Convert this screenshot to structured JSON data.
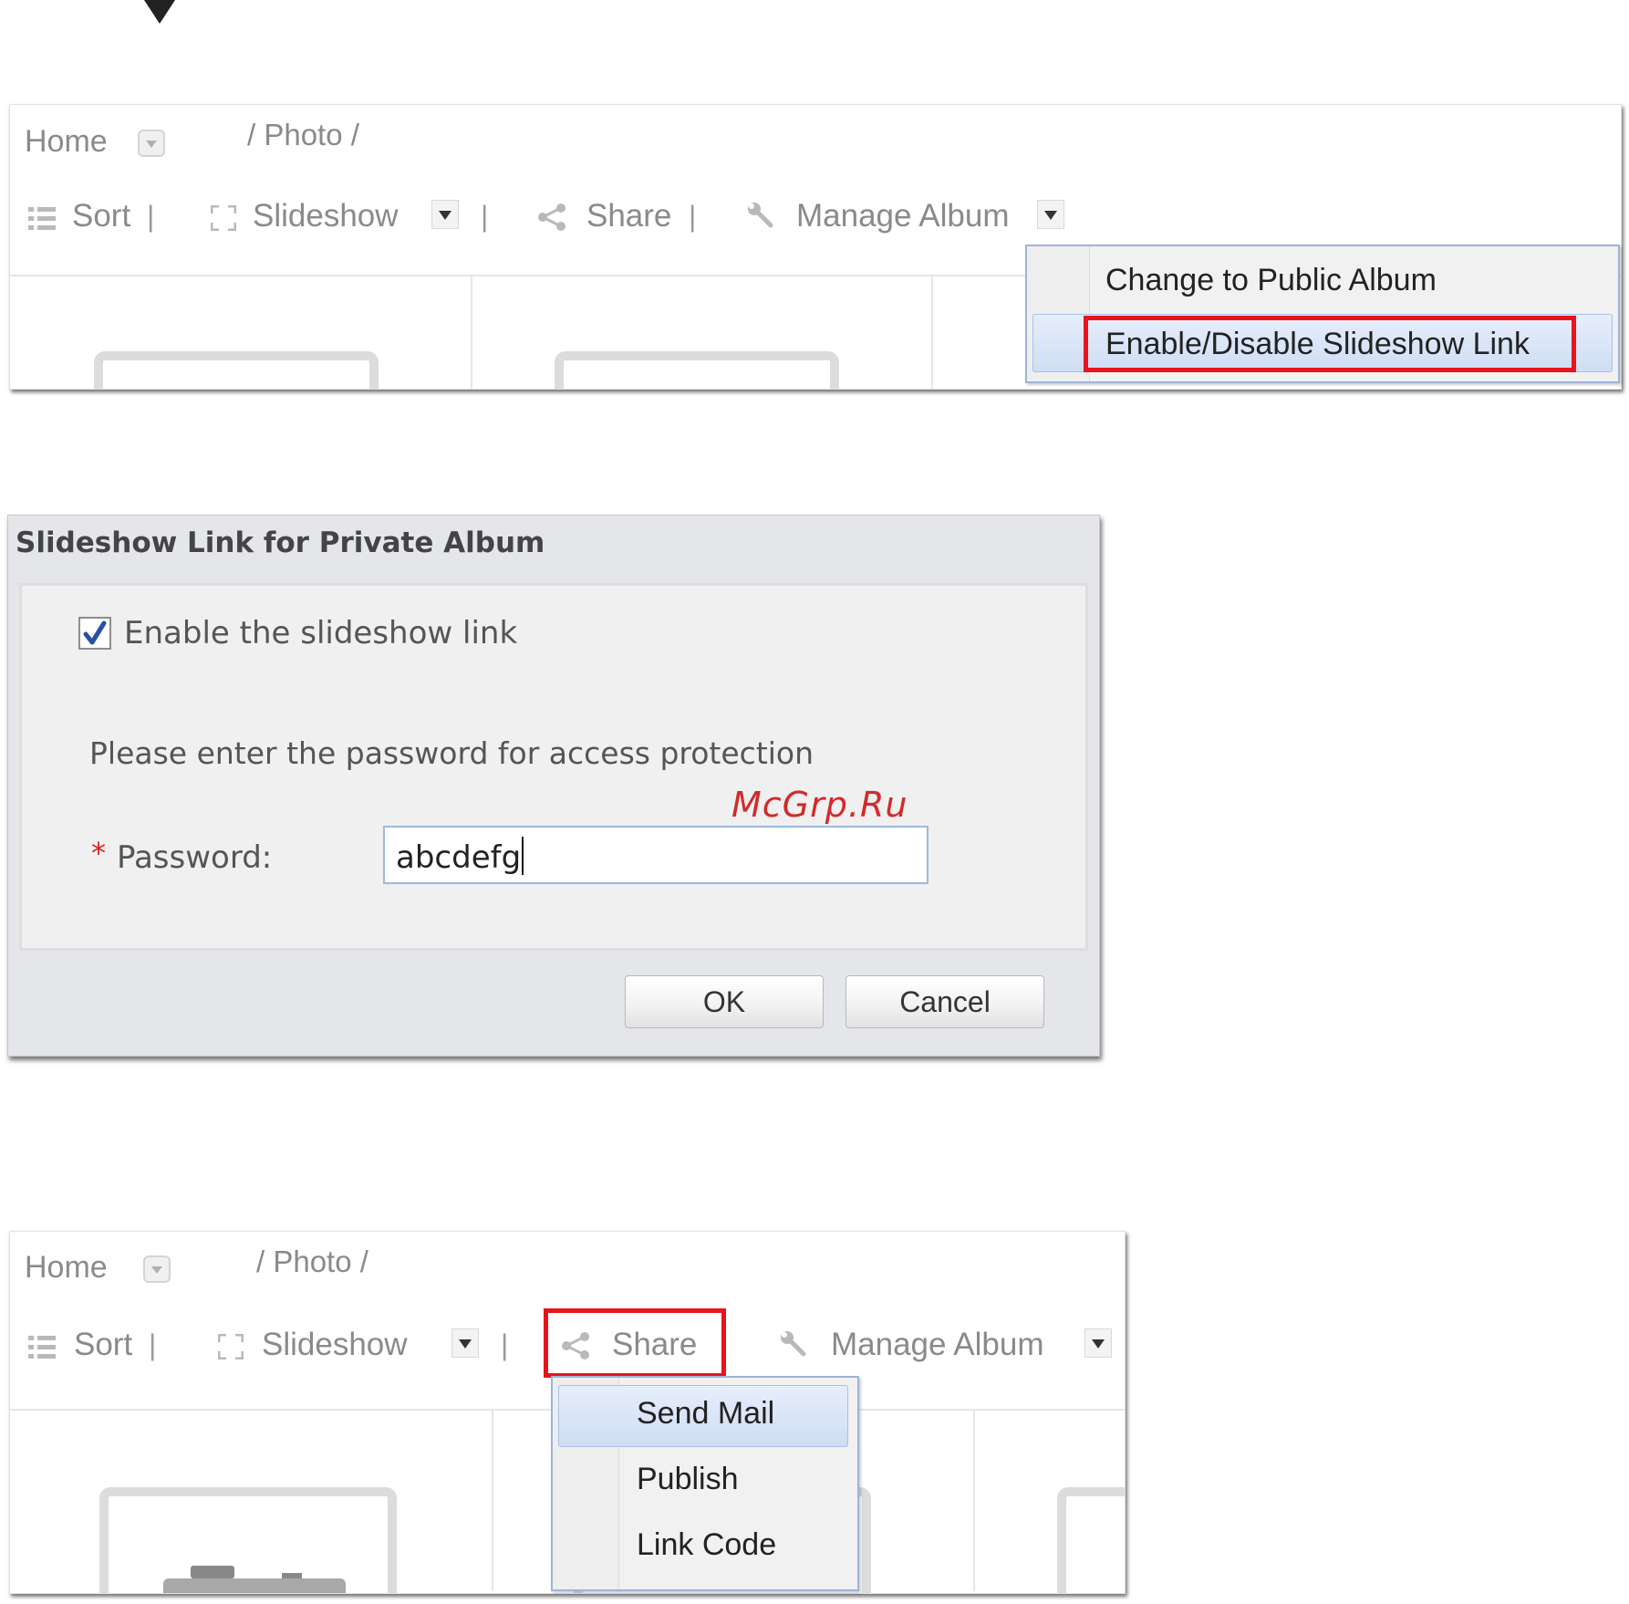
{
  "panel_top": {
    "breadcrumb": {
      "home": "Home",
      "path": "/ Photo /"
    },
    "toolbar": {
      "sort": "Sort",
      "slideshow": "Slideshow",
      "share": "Share",
      "manage_album": "Manage Album",
      "separator": "|"
    },
    "manage_menu": {
      "items": [
        "Change to Public Album",
        "Enable/Disable Slideshow Link"
      ],
      "highlighted_index": 1
    }
  },
  "dialog": {
    "title": "Slideshow Link for Private Album",
    "checkbox_label": "Enable the slideshow link",
    "checkbox_checked": true,
    "instruction": "Please enter the password for access protection",
    "required_marker": "*",
    "password_label": "Password:",
    "password_value": "abcdefg",
    "ok": "OK",
    "cancel": "Cancel"
  },
  "watermark": "McGrp.Ru",
  "panel_bottom": {
    "breadcrumb": {
      "home": "Home",
      "path": "/ Photo /"
    },
    "toolbar": {
      "sort": "Sort",
      "slideshow": "Slideshow",
      "share": "Share",
      "manage_album": "Manage Album",
      "separator": "|"
    },
    "share_menu": {
      "items": [
        "Send Mail",
        "Publish",
        "Link Code"
      ],
      "highlighted_index": 0
    }
  },
  "colors": {
    "highlight_border": "#e8141b",
    "menu_border": "#9db4d9",
    "required": "#e02020"
  },
  "icons": [
    "sort-list-icon",
    "slideshow-icon",
    "share-icon",
    "wrench-icon",
    "dropdown-arrow-icon",
    "checkmark-icon"
  ]
}
